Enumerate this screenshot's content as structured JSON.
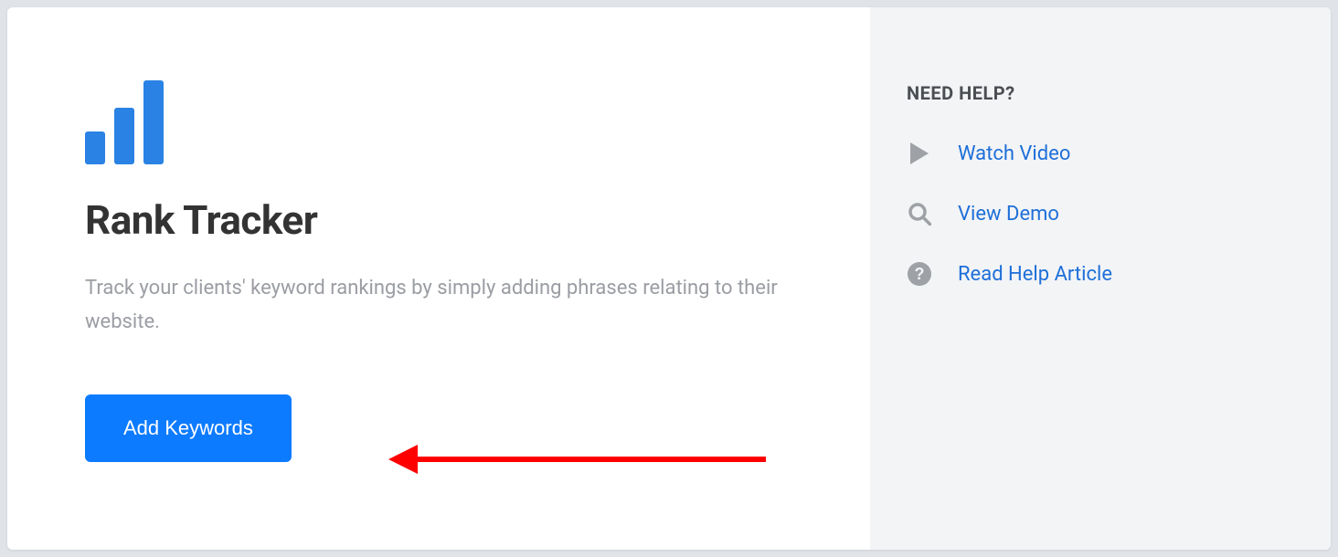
{
  "main": {
    "title": "Rank Tracker",
    "description": "Track your clients' keyword rankings by simply adding phrases relating to their website.",
    "add_button_label": "Add Keywords"
  },
  "sidebar": {
    "heading": "NEED HELP?",
    "items": [
      {
        "label": "Watch Video"
      },
      {
        "label": "View Demo"
      },
      {
        "label": "Read Help Article"
      }
    ]
  }
}
